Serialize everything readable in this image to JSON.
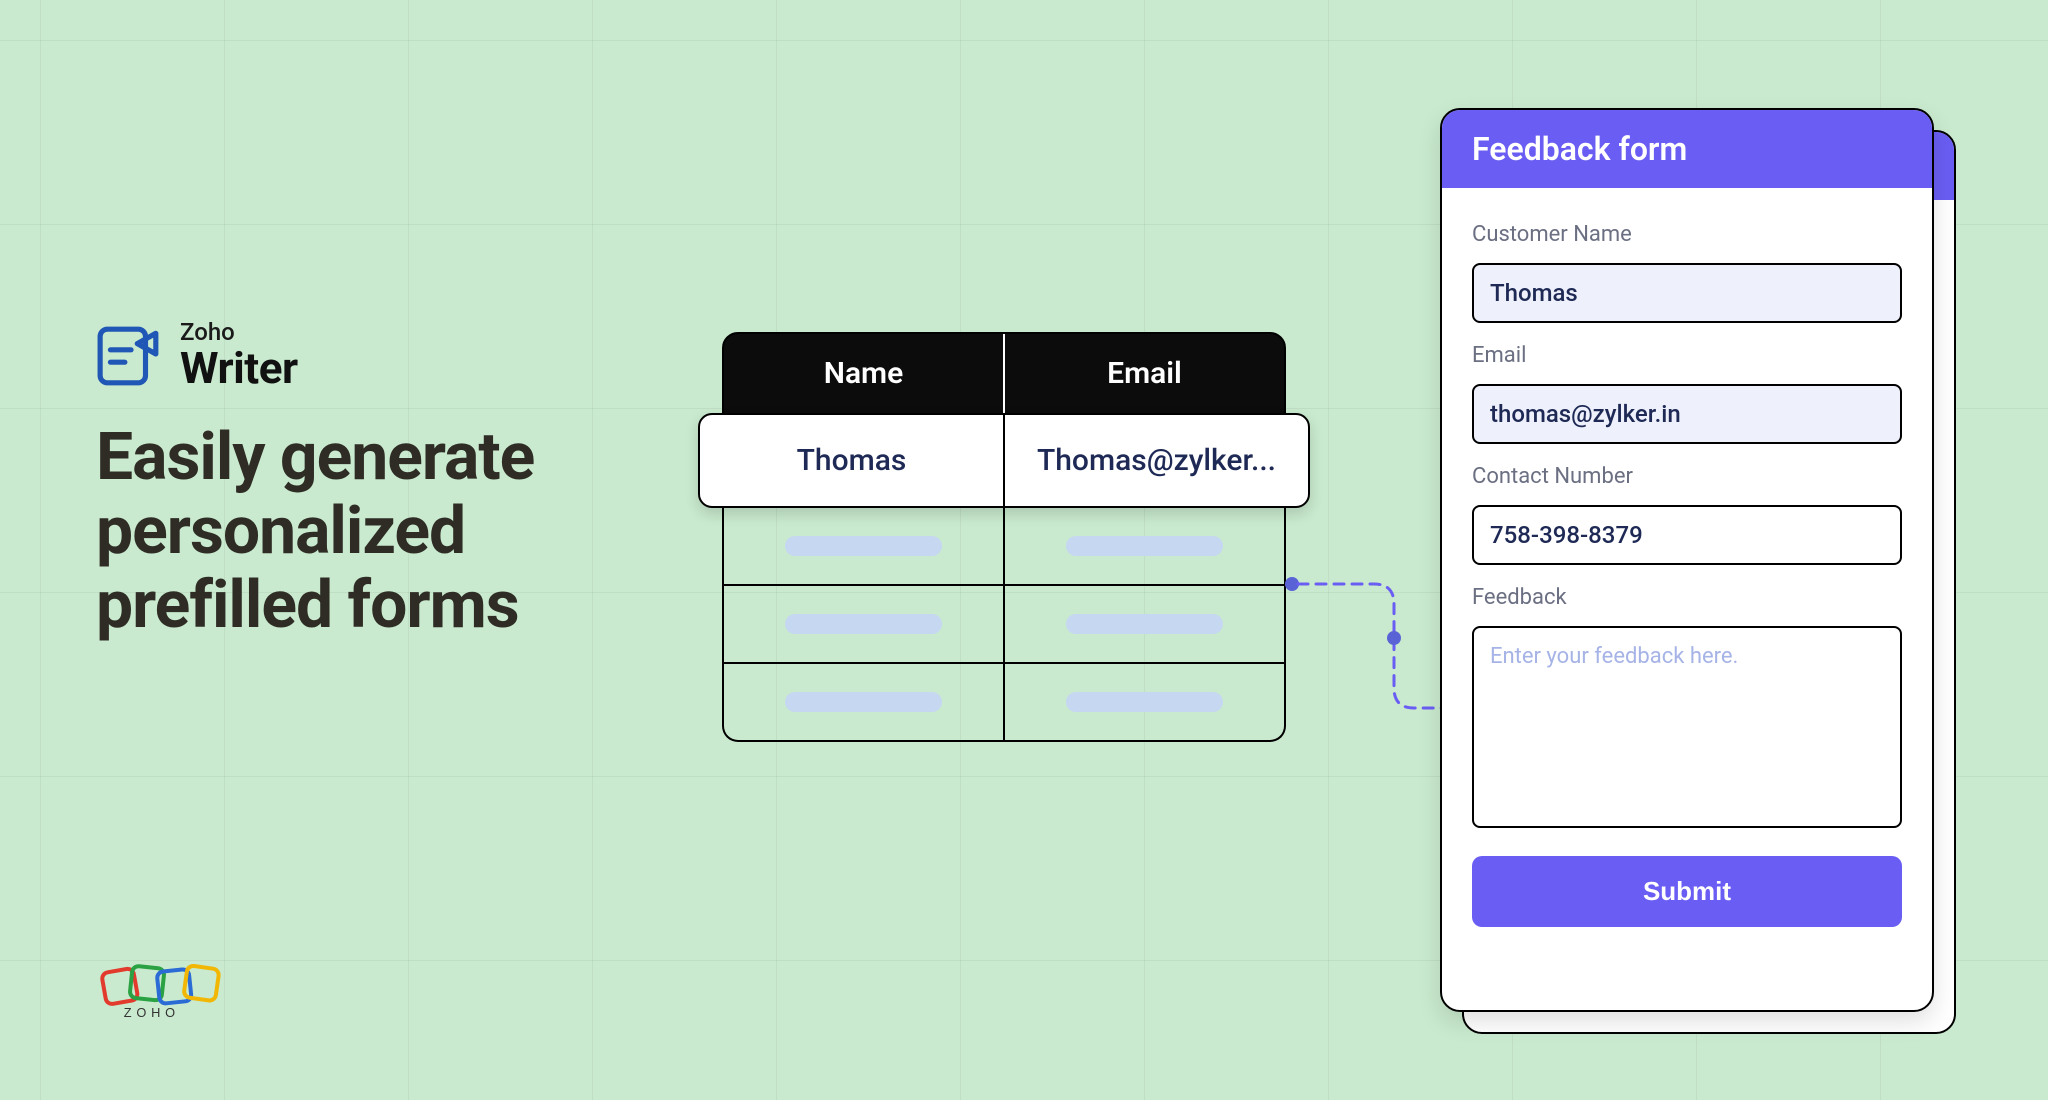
{
  "brand": {
    "kicker": "Zoho",
    "name": "Writer",
    "headline": "Easily generate personalized prefilled forms"
  },
  "table": {
    "headers": [
      "Name",
      "Email"
    ],
    "first_row": [
      "Thomas",
      "Thomas@zylker..."
    ]
  },
  "form": {
    "title": "Feedback form",
    "fields": {
      "name_label": "Customer Name",
      "name_value": "Thomas",
      "email_label": "Email",
      "email_value": "thomas@zylker.in",
      "contact_label": "Contact Number",
      "contact_value": "758-398-8379",
      "feedback_label": "Feedback",
      "feedback_placeholder": "Enter your feedback here."
    },
    "submit_label": "Submit"
  },
  "colors": {
    "accent": "#6a5df3",
    "bg": "#c9eace",
    "field_fill": "#eef1fb"
  },
  "logos": {
    "zoho_name": "ZOHO"
  }
}
